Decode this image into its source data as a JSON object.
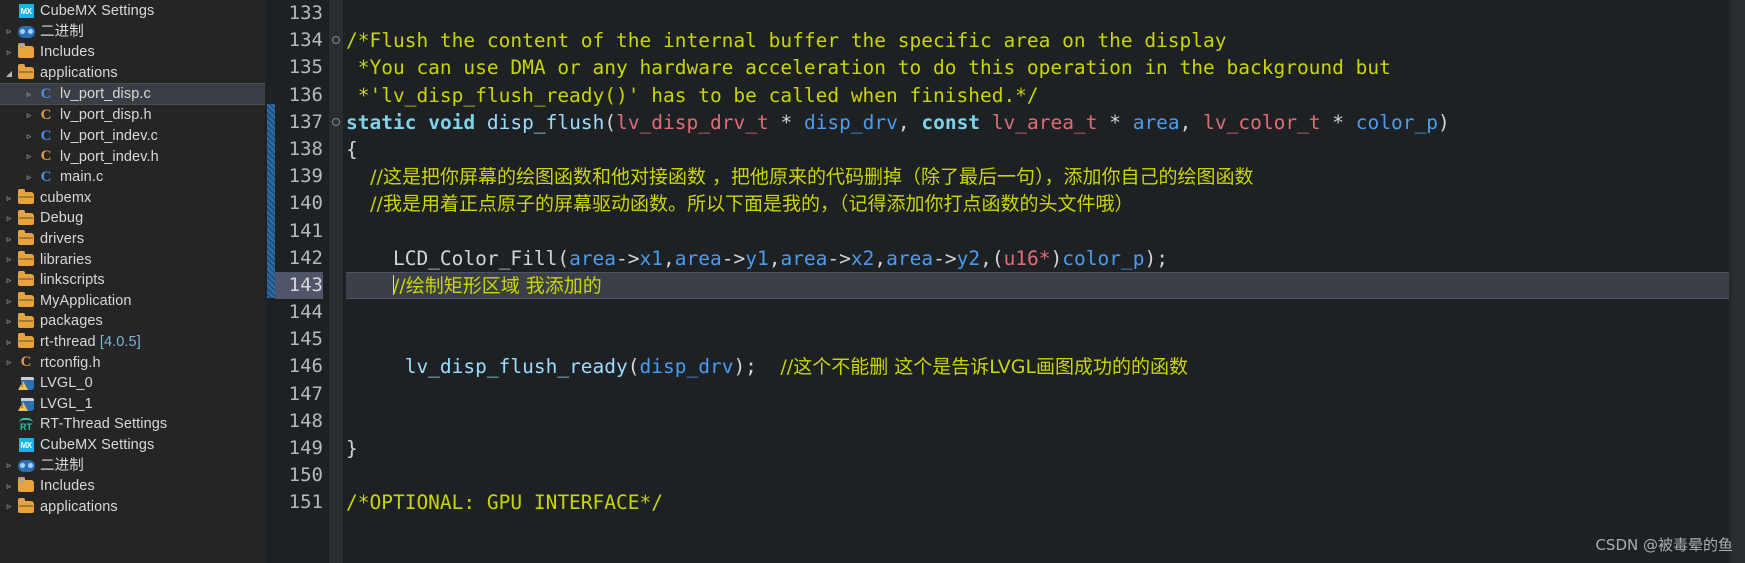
{
  "sidebar": {
    "items": [
      {
        "twisty": "blank",
        "icon": "cubemx-settings-icon",
        "label": "CubeMX Settings",
        "version": "",
        "selected": false
      },
      {
        "twisty": "collapsed",
        "icon": "binary-icon",
        "label": "二进制",
        "version": "",
        "selected": false
      },
      {
        "twisty": "collapsed",
        "icon": "includes-folder-icon",
        "label": "Includes",
        "version": "",
        "selected": false
      },
      {
        "twisty": "expanded",
        "icon": "folder-icon",
        "label": "applications",
        "version": "",
        "selected": false
      },
      {
        "twisty": "collapsed",
        "icon": "c-source-icon",
        "label": "lv_port_disp.c",
        "version": "",
        "selected": true,
        "indent": 1
      },
      {
        "twisty": "collapsed",
        "icon": "c-header-icon",
        "label": "lv_port_disp.h",
        "version": "",
        "selected": false,
        "indent": 1
      },
      {
        "twisty": "collapsed",
        "icon": "c-source-icon",
        "label": "lv_port_indev.c",
        "version": "",
        "selected": false,
        "indent": 1
      },
      {
        "twisty": "collapsed",
        "icon": "c-header-icon",
        "label": "lv_port_indev.h",
        "version": "",
        "selected": false,
        "indent": 1
      },
      {
        "twisty": "collapsed",
        "icon": "c-source-icon",
        "label": "main.c",
        "version": "",
        "selected": false,
        "indent": 1
      },
      {
        "twisty": "collapsed",
        "icon": "folder-icon",
        "label": "cubemx",
        "version": "",
        "selected": false
      },
      {
        "twisty": "collapsed",
        "icon": "folder-icon",
        "label": "Debug",
        "version": "",
        "selected": false
      },
      {
        "twisty": "collapsed",
        "icon": "folder-icon",
        "label": "drivers",
        "version": "",
        "selected": false
      },
      {
        "twisty": "collapsed",
        "icon": "folder-icon",
        "label": "libraries",
        "version": "",
        "selected": false
      },
      {
        "twisty": "collapsed",
        "icon": "folder-icon",
        "label": "linkscripts",
        "version": "",
        "selected": false
      },
      {
        "twisty": "collapsed",
        "icon": "folder-icon",
        "label": "MyApplication",
        "version": "",
        "selected": false
      },
      {
        "twisty": "collapsed",
        "icon": "folder-icon",
        "label": "packages",
        "version": "",
        "selected": false
      },
      {
        "twisty": "collapsed",
        "icon": "folder-icon",
        "label": "rt-thread",
        "version": "[4.0.5]",
        "selected": false
      },
      {
        "twisty": "collapsed",
        "icon": "c-header-icon",
        "label": "rtconfig.h",
        "version": "",
        "selected": false
      },
      {
        "twisty": "blank",
        "icon": "project-warning-icon",
        "label": "LVGL_0",
        "version": "",
        "selected": false,
        "root": true
      },
      {
        "twisty": "blank",
        "icon": "project-warning-icon",
        "label": "LVGL_1",
        "version": "",
        "selected": false,
        "root": true
      },
      {
        "twisty": "blank",
        "icon": "rt-thread-settings-icon",
        "label": "RT-Thread Settings",
        "version": "",
        "selected": false
      },
      {
        "twisty": "blank",
        "icon": "cubemx-settings-icon",
        "label": "CubeMX Settings",
        "version": "",
        "selected": false
      },
      {
        "twisty": "collapsed",
        "icon": "binary-icon",
        "label": "二进制",
        "version": "",
        "selected": false
      },
      {
        "twisty": "collapsed",
        "icon": "includes-folder-icon",
        "label": "Includes",
        "version": "",
        "selected": false
      },
      {
        "twisty": "collapsed",
        "icon": "folder-icon",
        "label": "applications",
        "version": "",
        "selected": false
      }
    ]
  },
  "editor": {
    "first_line": 133,
    "current_line": 143,
    "lines": [
      {
        "num": "133",
        "fold": false,
        "current": false,
        "highlight": false,
        "tokens": []
      },
      {
        "num": "134",
        "fold": true,
        "current": false,
        "highlight": false,
        "tokens": [
          {
            "c": "cm",
            "t": "/*Flush the content of the internal buffer the specific area on the display"
          }
        ]
      },
      {
        "num": "135",
        "fold": false,
        "current": false,
        "highlight": false,
        "tokens": [
          {
            "c": "cm",
            "t": " *You can use DMA or any hardware acceleration to do this operation in the background but"
          }
        ]
      },
      {
        "num": "136",
        "fold": false,
        "current": false,
        "highlight": false,
        "tokens": [
          {
            "c": "cm",
            "t": " *'lv_disp_flush_ready()' has to be called when finished.*/"
          }
        ]
      },
      {
        "num": "137",
        "fold": true,
        "current": false,
        "highlight": false,
        "tokens": [
          {
            "c": "kw",
            "t": "static"
          },
          {
            "c": "pl",
            "t": " "
          },
          {
            "c": "kw",
            "t": "void"
          },
          {
            "c": "pl",
            "t": " "
          },
          {
            "c": "fn",
            "t": "disp_flush"
          },
          {
            "c": "pl",
            "t": "("
          },
          {
            "c": "ty",
            "t": "lv_disp_drv_t"
          },
          {
            "c": "pl",
            "t": " * "
          },
          {
            "c": "var",
            "t": "disp_drv"
          },
          {
            "c": "pl",
            "t": ", "
          },
          {
            "c": "kw",
            "t": "const"
          },
          {
            "c": "pl",
            "t": " "
          },
          {
            "c": "ty",
            "t": "lv_area_t"
          },
          {
            "c": "pl",
            "t": " * "
          },
          {
            "c": "var",
            "t": "area"
          },
          {
            "c": "pl",
            "t": ", "
          },
          {
            "c": "ty",
            "t": "lv_color_t"
          },
          {
            "c": "pl",
            "t": " * "
          },
          {
            "c": "var",
            "t": "color_p"
          },
          {
            "c": "pl",
            "t": ")"
          }
        ]
      },
      {
        "num": "138",
        "fold": false,
        "current": false,
        "highlight": false,
        "tokens": [
          {
            "c": "pl",
            "t": "{"
          }
        ]
      },
      {
        "num": "139",
        "fold": false,
        "current": false,
        "highlight": false,
        "tokens": [
          {
            "c": "cmz",
            "t": "    //这是把你屏幕的绘图函数和他对接函数 ，把他原来的代码删掉（除了最后一句），添加你自己的绘图函数"
          }
        ]
      },
      {
        "num": "140",
        "fold": false,
        "current": false,
        "highlight": false,
        "tokens": [
          {
            "c": "cmz",
            "t": "    //我是用着正点原子的屏幕驱动函数。所以下面是我的，（记得添加你打点函数的头文件哦）"
          }
        ]
      },
      {
        "num": "141",
        "fold": false,
        "current": false,
        "highlight": false,
        "tokens": []
      },
      {
        "num": "142",
        "fold": false,
        "current": false,
        "highlight": false,
        "tokens": [
          {
            "c": "pl",
            "t": "    LCD_Color_Fill"
          },
          {
            "c": "pl",
            "t": "("
          },
          {
            "c": "var",
            "t": "area"
          },
          {
            "c": "pl",
            "t": "->"
          },
          {
            "c": "var",
            "t": "x1"
          },
          {
            "c": "pl",
            "t": ","
          },
          {
            "c": "var",
            "t": "area"
          },
          {
            "c": "pl",
            "t": "->"
          },
          {
            "c": "var",
            "t": "y1"
          },
          {
            "c": "pl",
            "t": ","
          },
          {
            "c": "var",
            "t": "area"
          },
          {
            "c": "pl",
            "t": "->"
          },
          {
            "c": "var",
            "t": "x2"
          },
          {
            "c": "pl",
            "t": ","
          },
          {
            "c": "var",
            "t": "area"
          },
          {
            "c": "pl",
            "t": "->"
          },
          {
            "c": "var",
            "t": "y2"
          },
          {
            "c": "pl",
            "t": ",("
          },
          {
            "c": "ty",
            "t": "u16*"
          },
          {
            "c": "pl",
            "t": ")"
          },
          {
            "c": "var",
            "t": "color_p"
          },
          {
            "c": "pl",
            "t": ");"
          }
        ]
      },
      {
        "num": "143",
        "fold": false,
        "current": true,
        "highlight": true,
        "tokens": [
          {
            "c": "cmz",
            "t": "    //绘制矩形区域 我添加的"
          }
        ]
      },
      {
        "num": "144",
        "fold": false,
        "current": false,
        "highlight": false,
        "tokens": []
      },
      {
        "num": "145",
        "fold": false,
        "current": false,
        "highlight": false,
        "tokens": []
      },
      {
        "num": "146",
        "fold": false,
        "current": false,
        "highlight": false,
        "tokens": [
          {
            "c": "pl",
            "t": "     "
          },
          {
            "c": "fn",
            "t": "lv_disp_flush_ready"
          },
          {
            "c": "pl",
            "t": "("
          },
          {
            "c": "var",
            "t": "disp_drv"
          },
          {
            "c": "pl",
            "t": ");  "
          },
          {
            "c": "cmz",
            "t": "//这个不能删 这个是告诉LVGL画图成功的的函数"
          }
        ]
      },
      {
        "num": "147",
        "fold": false,
        "current": false,
        "highlight": false,
        "tokens": []
      },
      {
        "num": "148",
        "fold": false,
        "current": false,
        "highlight": false,
        "tokens": []
      },
      {
        "num": "149",
        "fold": false,
        "current": false,
        "highlight": false,
        "tokens": [
          {
            "c": "pl",
            "t": "}"
          }
        ]
      },
      {
        "num": "150",
        "fold": false,
        "current": false,
        "highlight": false,
        "tokens": []
      },
      {
        "num": "151",
        "fold": false,
        "current": false,
        "highlight": false,
        "tokens": [
          {
            "c": "cm",
            "t": "/*OPTIONAL: GPU INTERFACE*/"
          }
        ]
      }
    ]
  },
  "watermark": {
    "text": "CSDN @被毒晕的鱼"
  },
  "colors": {
    "editor_bg": "#1e2124",
    "sidebar_bg": "#252526",
    "comment": "#c8d500",
    "keyword": "#7fd3e8",
    "type": "#e06c75",
    "variable": "#4a9cf0",
    "function": "#9cdcfe",
    "selection": "#3b4048",
    "current_line_gutter": "#51556a"
  }
}
